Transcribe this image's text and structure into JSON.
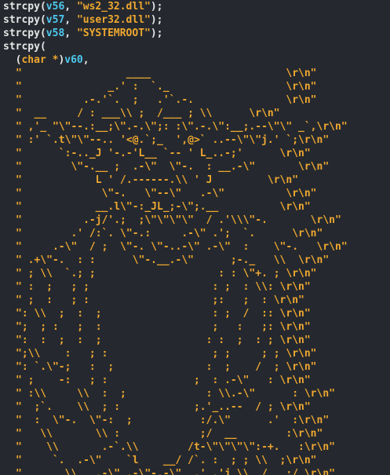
{
  "code": {
    "calls": [
      {
        "fn": "strcpy",
        "var": "v56",
        "str": "\"ws2_32.dll\""
      },
      {
        "fn": "strcpy",
        "var": "v57",
        "str": "\"user32.dll\""
      },
      {
        "fn": "strcpy",
        "var": "v58",
        "str": "\"SYSTEMROOT\""
      }
    ],
    "final_call": {
      "fn": "strcpy",
      "open": "("
    },
    "cast_line": {
      "indent": "  ",
      "cast": "char *",
      "var": "v60",
      "tail": ","
    },
    "art_lines": [
      "\"                 ____                      \\r\\n\"",
      "\"              _.' :  `._                   \\r\\n\"",
      "\"          .-.'`.  ;   .'`.-.               \\r\\n\"",
      "\"  __     / : ___\\\\ ;  /___ ; \\\\      \\r\\n\"",
      "\" ,'_ \"\\\"--.:__;\\\".-.\\\";: :\\\".-.\\\":__;.--\\\"\\\" _`,\\r\\n\"",
      "\" :' `.t\\\"\\\"--.. '<@.`;_  ',@>` ..--\\\"\\\"j.' `;\\r\\n\"",
      "\"      `:-.._J '-.-'L__ `-- ' L_..-;'      \\r\\n\"",
      "\"        \\\"-.__ ;  .-\\\"  \\\"-.  : __.-\\\"       \\r\\n\"",
      "\"            L ' /.------.\\\\ ' J         \\r\\n\"",
      "\"             \\\"-.   \\\"--\\\"   .-\\\"          \\r\\n\"",
      "\"            __.l\\\"-:_JL_;-\\\";.__          \\r\\n\"",
      "\"          .-j/'.;  ;\\\"\\\"\\\"\\\"  / .'\\\\\\\"-.       \\r\\n\"",
      "\"        .' /:`. \\\"-.:     .-\\\" .';  `.      \\r\\n\"",
      "\"     .-\\\"  / ;  \\\"-. \\\"-..-\\\" .-\\\"  :    \\\"-.   \\r\\n\"",
      "\" .+\\\"-.  : :      \\\"-.__.-\\\"      ;-._   \\\\  \\r\\n\"",
      "\" ; \\\\  `.; ;                    : : \\\"+. ; \\r\\n\"",
      "\" :  ;   ; ;                    : ;  : \\\\: \\r\\n\"",
      "\" ;  :   ; :                    ;:   ;  : \\r\\n\"",
      "\": \\\\  ;  :  ;                  : ;  /  :: \\r\\n\"",
      "\";  ; :   ;  :                  ;   :   ;: \\r\\n\"",
      "\":  :  ;  :  ;                 : :  ;  : ; \\r\\n\"",
      "\";\\\\    :   ; :                 ; ;     ; ; \\r\\n\"",
      "\": `.\\\"-;   :  ;               :  ;    /  ; \\r\\n\"",
      "\" ;    -:   ; :              ;  : .-\\\"   : \\r\\n\"",
      "\" :\\\\     \\\\  :  ;             : \\\\.-\\\"      : \\r\\n\"",
      "\"  ;`.    \\\\  ; :            ;.'_..--  / ; \\r\\n\"",
      "\"  :  \\\"-.  \\\"-:  ;           :/.\\\"      .'  :\\r\\n\"",
      "\"   \\\\       \\\\ :             ;/  __        :\\r\\n\"",
      "\"    \\\\       .-`.\\\\        /t-\\\"\\\"\\\"\\\":-+.   :\\r\\n\"",
      "\"     `.  .-\\\"    `l    __/ /`. :  ; ; \\\\  ;\\r\\n\"",
      "\"       \\\\   .-\\\" .-\\\"-.-\\\"  .' .'j \\\\  /   ;/ \\r\\n\""
    ]
  }
}
